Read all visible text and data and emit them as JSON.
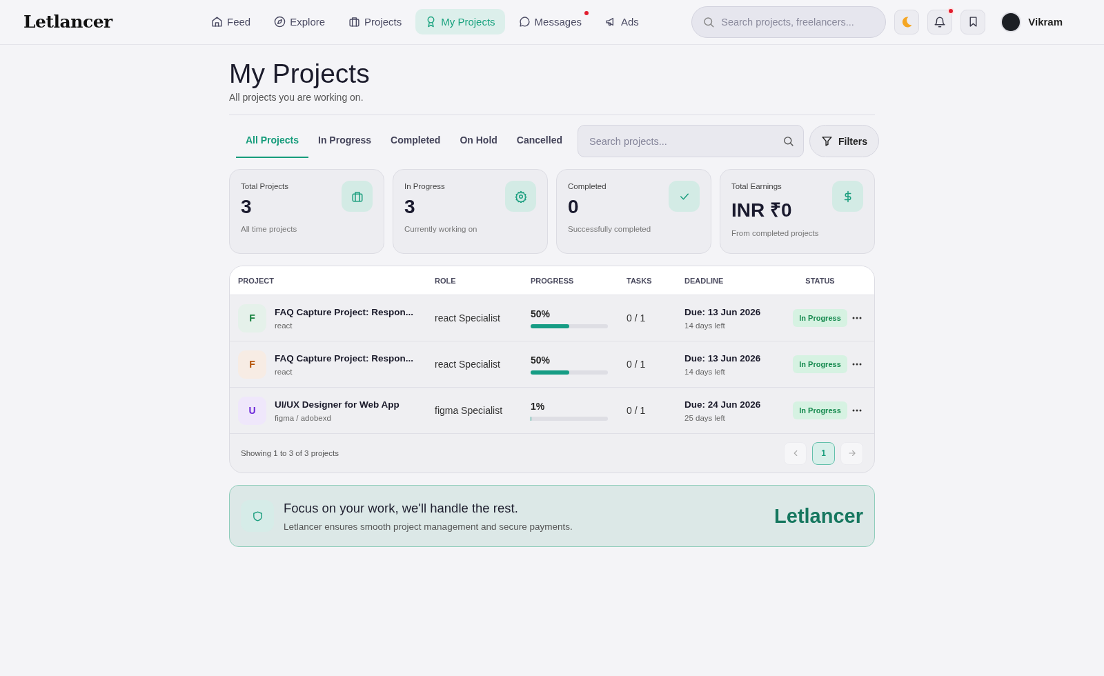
{
  "header": {
    "logo": "Letlancer",
    "nav": [
      {
        "label": "Feed",
        "selected": false,
        "dot": false
      },
      {
        "label": "Explore",
        "selected": false,
        "dot": false
      },
      {
        "label": "Projects",
        "selected": false,
        "dot": false
      },
      {
        "label": "My Projects",
        "selected": true,
        "dot": false
      },
      {
        "label": "Messages",
        "selected": false,
        "dot": true
      },
      {
        "label": "Ads",
        "selected": false,
        "dot": false
      }
    ],
    "search": {
      "placeholder": "Search projects, freelancers..."
    },
    "notifications_unread": true,
    "user": {
      "name": "Vikram"
    }
  },
  "page": {
    "title": "My Projects",
    "subtitle": "All projects you are working on."
  },
  "tabs": [
    {
      "label": "All Projects",
      "selected": true
    },
    {
      "label": "In Progress",
      "selected": false
    },
    {
      "label": "Completed",
      "selected": false
    },
    {
      "label": "On Hold",
      "selected": false
    },
    {
      "label": "Cancelled",
      "selected": false
    }
  ],
  "project_search": {
    "placeholder": "Search projects..."
  },
  "filters_button": "Filters",
  "stats": [
    {
      "label": "Total Projects",
      "value": "3",
      "caption": "All time projects"
    },
    {
      "label": "In Progress",
      "value": "3",
      "caption": "Currently working on"
    },
    {
      "label": "Completed",
      "value": "0",
      "caption": "Successfully completed"
    },
    {
      "label": "Total Earnings",
      "value": "INR ₹0",
      "caption": "From completed projects"
    }
  ],
  "table": {
    "columns": [
      "PROJECT",
      "ROLE",
      "PROGRESS",
      "TASKS",
      "DEADLINE",
      "STATUS"
    ],
    "rows": [
      {
        "initial": "F",
        "color": "#15803d",
        "title": "FAQ Capture Project: Respon...",
        "skills": "react",
        "role": "react Specialist",
        "progress": "50%",
        "level": 0.5,
        "tasks": "0 / 1",
        "deadline": "Due: 13 Jun 2026",
        "days_left": "14 days left",
        "status": "In Progress"
      },
      {
        "initial": "F",
        "color": "#b45309",
        "title": "FAQ Capture Project: Respon...",
        "skills": "react",
        "role": "react Specialist",
        "progress": "50%",
        "level": 0.5,
        "tasks": "0 / 1",
        "deadline": "Due: 13 Jun 2026",
        "days_left": "14 days left",
        "status": "In Progress"
      },
      {
        "initial": "U",
        "color": "#6d28d9",
        "title": "UI/UX Designer for Web App",
        "skills": "figma / adobexd",
        "role": "figma Specialist",
        "progress": "1%",
        "level": 0.01,
        "tasks": "0 / 1",
        "deadline": "Due: 24 Jun 2026",
        "days_left": "25 days left",
        "status": "In Progress"
      }
    ],
    "footer": "Showing 1 to 3 of 3 projects",
    "pages": [
      {
        "label": "1",
        "selected": true
      }
    ]
  },
  "banner": {
    "title": "Focus on your work, we'll handle the rest.",
    "text": "Letlancer ensures smooth project management and secure payments.",
    "brand": "Letlancer"
  }
}
